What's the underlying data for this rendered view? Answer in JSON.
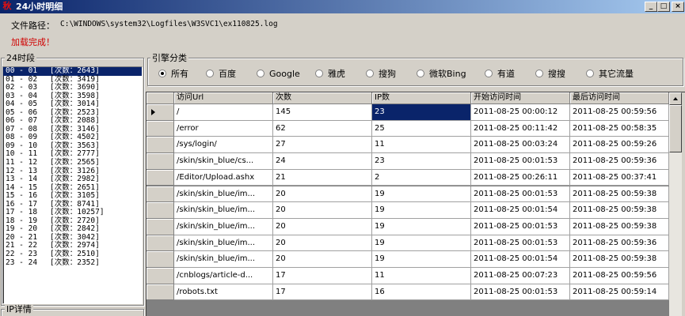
{
  "window": {
    "icon_glyph": "秋",
    "title": "24小时明细",
    "buttons": [
      "_",
      "□",
      "×"
    ]
  },
  "file_path": {
    "label": "文件路径：",
    "value": "C:\\WINDOWS\\system32\\Logfiles\\W3SVC1\\ex110825.log"
  },
  "status": "加载完成！",
  "hours_group": {
    "title": "24时段",
    "items": [
      {
        "range": "00 - 01",
        "count": "[次数：2643]"
      },
      {
        "range": "01 - 02",
        "count": "[次数：3419]"
      },
      {
        "range": "02 - 03",
        "count": "[次数：3690]"
      },
      {
        "range": "03 - 04",
        "count": "[次数：3598]"
      },
      {
        "range": "04 - 05",
        "count": "[次数：3014]"
      },
      {
        "range": "05 - 06",
        "count": "[次数：2523]"
      },
      {
        "range": "06 - 07",
        "count": "[次数：2088]"
      },
      {
        "range": "07 - 08",
        "count": "[次数：3146]"
      },
      {
        "range": "08 - 09",
        "count": "[次数：4502]"
      },
      {
        "range": "09 - 10",
        "count": "[次数：3563]"
      },
      {
        "range": "10 - 11",
        "count": "[次数：2777]"
      },
      {
        "range": "11 - 12",
        "count": "[次数：2565]"
      },
      {
        "range": "12 - 13",
        "count": "[次数：3126]"
      },
      {
        "range": "13 - 14",
        "count": "[次数：2982]"
      },
      {
        "range": "14 - 15",
        "count": "[次数：2651]"
      },
      {
        "range": "15 - 16",
        "count": "[次数：3105]"
      },
      {
        "range": "16 - 17",
        "count": "[次数：8741]"
      },
      {
        "range": "17 - 18",
        "count": "[次数：10257]"
      },
      {
        "range": "18 - 19",
        "count": "[次数：2720]"
      },
      {
        "range": "19 - 20",
        "count": "[次数：2842]"
      },
      {
        "range": "20 - 21",
        "count": "[次数：3042]"
      },
      {
        "range": "21 - 22",
        "count": "[次数：2974]"
      },
      {
        "range": "22 - 23",
        "count": "[次数：2510]"
      },
      {
        "range": "23 - 24",
        "count": "[次数：2352]"
      }
    ]
  },
  "ip_group": {
    "title": "IP详情"
  },
  "engine_group": {
    "title": "引擎分类",
    "options": [
      "所有",
      "百度",
      "Google",
      "雅虎",
      "搜狗",
      "微软Bing",
      "有道",
      "搜搜",
      "其它流量"
    ],
    "selected": "所有"
  },
  "table": {
    "columns": [
      "访问Url",
      "次数",
      "IP数",
      "开始访问时间",
      "最后访问时间"
    ],
    "rows": [
      [
        "/",
        "145",
        "23",
        "2011-08-25 00:00:12",
        "2011-08-25 00:59:56"
      ],
      [
        "/error",
        "62",
        "25",
        "2011-08-25 00:11:42",
        "2011-08-25 00:58:35"
      ],
      [
        "/sys/login/",
        "27",
        "11",
        "2011-08-25 00:03:24",
        "2011-08-25 00:59:26"
      ],
      [
        "/skin/skin_blue/cs...",
        "24",
        "23",
        "2011-08-25 00:01:53",
        "2011-08-25 00:59:36"
      ],
      [
        "/Editor/Upload.ashx",
        "21",
        "2",
        "2011-08-25 00:26:11",
        "2011-08-25 00:37:41"
      ],
      [
        "/skin/skin_blue/im...",
        "20",
        "19",
        "2011-08-25 00:01:53",
        "2011-08-25 00:59:38"
      ],
      [
        "/skin/skin_blue/im...",
        "20",
        "19",
        "2011-08-25 00:01:54",
        "2011-08-25 00:59:38"
      ],
      [
        "/skin/skin_blue/im...",
        "20",
        "19",
        "2011-08-25 00:01:53",
        "2011-08-25 00:59:38"
      ],
      [
        "/skin/skin_blue/im...",
        "20",
        "19",
        "2011-08-25 00:01:53",
        "2011-08-25 00:59:36"
      ],
      [
        "/skin/skin_blue/im...",
        "20",
        "19",
        "2011-08-25 00:01:54",
        "2011-08-25 00:59:38"
      ],
      [
        "/cnblogs/article-d...",
        "17",
        "11",
        "2011-08-25 00:07:23",
        "2011-08-25 00:59:56"
      ],
      [
        "/robots.txt",
        "17",
        "16",
        "2011-08-25 00:01:53",
        "2011-08-25 00:59:14"
      ]
    ]
  }
}
